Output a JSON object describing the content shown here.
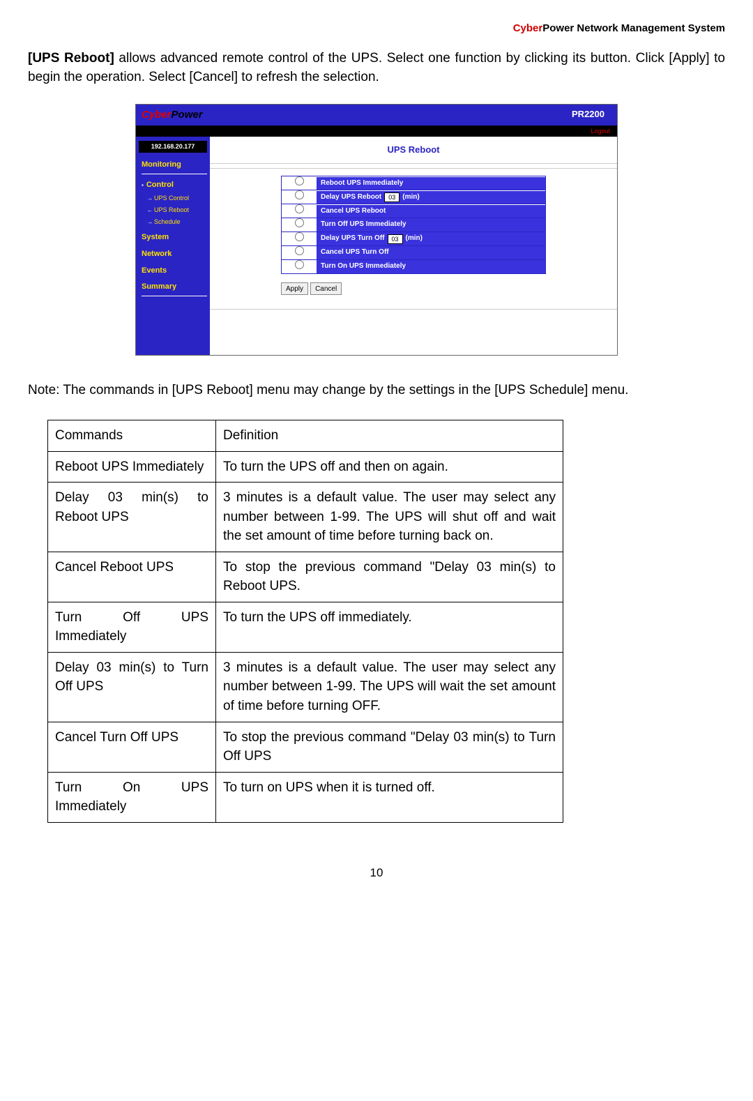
{
  "header": {
    "cyber": "Cyber",
    "rest": "Power Network Management System"
  },
  "intro": {
    "bold": "[UPS Reboot]",
    "text": " allows advanced remote control of the UPS.   Select one function by clicking its button.   Click [Apply] to begin the operation.   Select [Cancel] to refresh the selection."
  },
  "shot": {
    "logo_cyber": "Cyber",
    "logo_power": "Power",
    "model": "PR2200",
    "logout": "Logout",
    "ip": "192.168.20.177",
    "menu": {
      "monitoring": "Monitoring",
      "control": "Control",
      "ups_control": "UPS Control",
      "ups_reboot": "UPS Reboot",
      "schedule": "Schedule",
      "system": "System",
      "network": "Network",
      "events": "Events",
      "summary": "Summary"
    },
    "panel_title": "UPS Reboot",
    "options": [
      {
        "label": "Reboot UPS Immediately"
      },
      {
        "label_pre": "Delay UPS Reboot",
        "input": "03",
        "label_post": "(min)"
      },
      {
        "label": "Cancel UPS Reboot"
      },
      {
        "label": "Turn Off UPS Immediately"
      },
      {
        "label_pre": "Delay UPS Turn Off",
        "input": "03",
        "label_post": "(min)"
      },
      {
        "label": "Cancel UPS Turn Off"
      },
      {
        "label": "Turn On UPS Immediately"
      }
    ],
    "apply": "Apply",
    "cancel": "Cancel"
  },
  "note": "Note: The commands in [UPS Reboot] menu may change by the settings in the [UPS Schedule] menu.",
  "table": {
    "head_cmd": "Commands",
    "head_def": "Definition",
    "rows": [
      {
        "c": "Reboot UPS Immediately",
        "d": "To turn the UPS off and then on again."
      },
      {
        "c": "Delay 03 min(s) to Reboot UPS",
        "d": "3 minutes is a default value. The user may select any number between 1-99. The UPS will shut off and wait the set amount of time before turning back on."
      },
      {
        "c": "Cancel Reboot UPS",
        "d": "To stop the previous command \"Delay 03 min(s) to Reboot UPS."
      },
      {
        "c": "Turn Off UPS Immediately",
        "d": "To turn the UPS off immediately."
      },
      {
        "c": "Delay 03 min(s) to Turn Off UPS",
        "d": "3 minutes is a default value. The user may select any number between 1-99. The UPS will wait the set amount of time before turning OFF."
      },
      {
        "c": "Cancel Turn Off UPS",
        "d": "To stop the previous command \"Delay 03 min(s) to Turn Off UPS"
      },
      {
        "c": "Turn On UPS Immediately",
        "d": "To turn on UPS when it is turned off."
      }
    ]
  },
  "page_number": "10"
}
